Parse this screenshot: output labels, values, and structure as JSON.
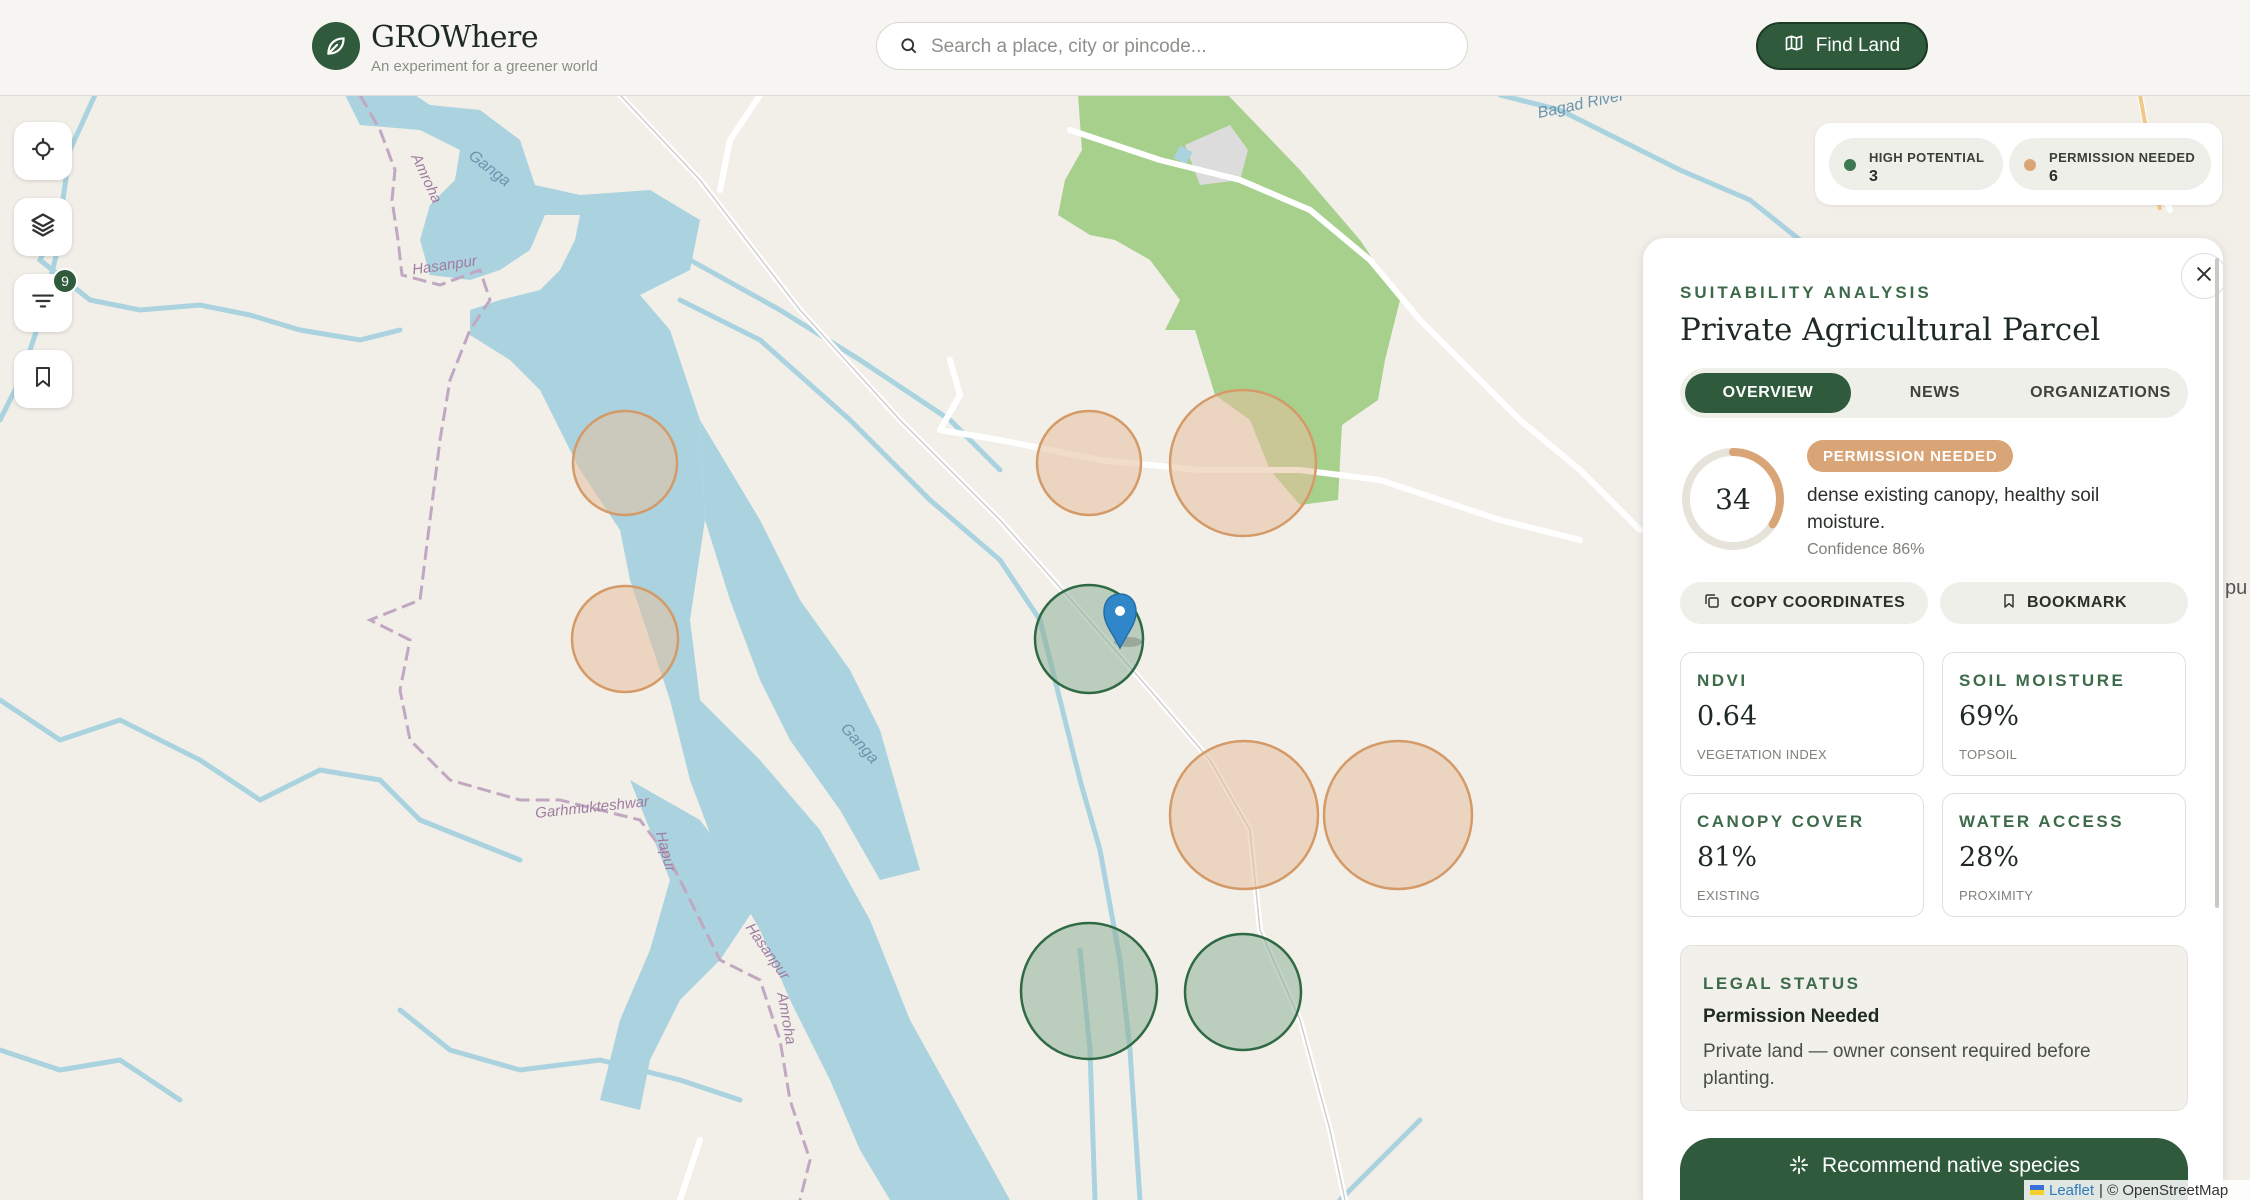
{
  "brand": {
    "name": "GROWhere",
    "tagline": "An experiment for a greener world"
  },
  "search": {
    "placeholder": "Search a place, city or pincode..."
  },
  "header": {
    "find_label": "Find Land"
  },
  "tools": {
    "filter_badge": "9"
  },
  "legend": {
    "high": {
      "label": "HIGH POTENTIAL",
      "count": "3",
      "color": "#3d7a52"
    },
    "perm": {
      "label": "PERMISSION NEEDED",
      "count": "6",
      "color": "#d9a577"
    }
  },
  "map_labels": {
    "ganga1": "Ganga",
    "ganga2": "Ganga",
    "amroha1": "Amroha",
    "hasanpur1": "Hasanpur",
    "garh": "Garhmukteshwar",
    "hapur": "Hapur",
    "hasanpur2": "Hasanpur",
    "amroha2": "Amroha",
    "bagad": "Bagad River",
    "edge_pu": "pu"
  },
  "panel": {
    "eyebrow": "SUITABILITY ANALYSIS",
    "title": "Private Agricultural Parcel",
    "tabs": [
      "OVERVIEW",
      "NEWS",
      "ORGANIZATIONS"
    ],
    "score": "34",
    "score_fraction": 0.34,
    "badge": "PERMISSION NEEDED",
    "description": "dense existing canopy, healthy soil moisture.",
    "confidence": "Confidence 86%",
    "copy_label": "COPY COORDINATES",
    "bookmark_label": "BOOKMARK",
    "metrics": [
      {
        "label": "NDVI",
        "value": "0.64",
        "sub": "VEGETATION INDEX"
      },
      {
        "label": "SOIL MOISTURE",
        "value": "69%",
        "sub": "TOPSOIL"
      },
      {
        "label": "CANOPY COVER",
        "value": "81%",
        "sub": "EXISTING"
      },
      {
        "label": "WATER ACCESS",
        "value": "28%",
        "sub": "PROXIMITY"
      }
    ],
    "legal": {
      "label": "LEGAL STATUS",
      "title": "Permission Needed",
      "text": "Private land — owner consent required before planting."
    },
    "recommend_label": "Recommend native species"
  },
  "attribution": {
    "leaflet": "Leaflet",
    "osm": "| © OpenStreetMap"
  },
  "colors": {
    "accent": "#2f5a3c",
    "permission": "#d9a577",
    "water": "#aad3df",
    "forest": "#a8d08d"
  }
}
